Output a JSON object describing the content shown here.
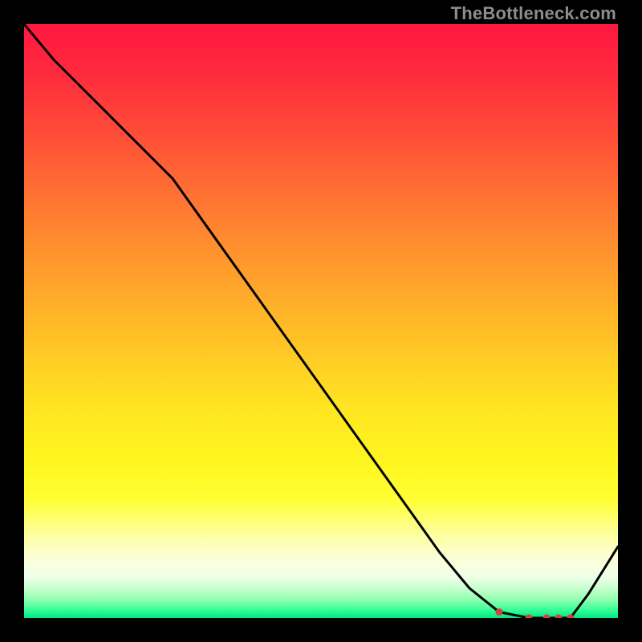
{
  "watermark": "TheBottleneck.com",
  "chart_data": {
    "type": "line",
    "title": "",
    "xlabel": "",
    "ylabel": "",
    "xlim": [
      0,
      100
    ],
    "ylim": [
      0,
      100
    ],
    "x": [
      0,
      5,
      10,
      15,
      20,
      25,
      30,
      35,
      40,
      45,
      50,
      55,
      60,
      65,
      70,
      75,
      80,
      85,
      88,
      90,
      92,
      95,
      100
    ],
    "values": [
      100,
      94,
      89,
      84,
      79,
      74,
      67,
      60,
      53,
      46,
      39,
      32,
      25,
      18,
      11,
      5,
      1,
      0,
      0,
      0,
      0,
      4,
      12
    ],
    "marker_indices": [
      16,
      17,
      18,
      19,
      20
    ],
    "curve_color": "#000000",
    "marker_color": "#d2433f",
    "marker_radius_px": 4.5
  }
}
